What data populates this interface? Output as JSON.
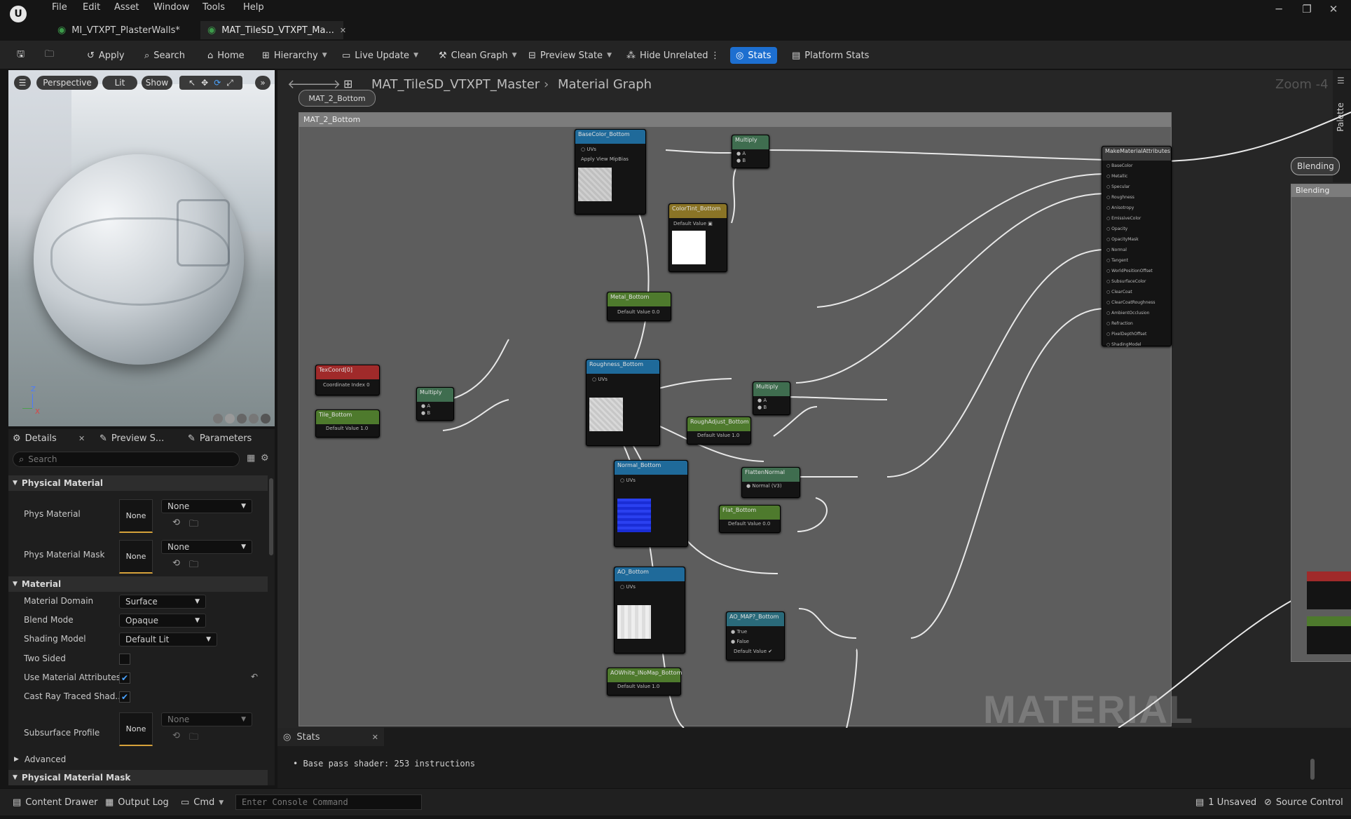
{
  "menu": [
    "File",
    "Edit",
    "Asset",
    "Window",
    "Tools",
    "Help"
  ],
  "tabs": [
    {
      "label": "MI_VTXPT_PlasterWalls*"
    },
    {
      "label": "MAT_TileSD_VTXPT_Ma..."
    }
  ],
  "toolbar": {
    "apply": "Apply",
    "search": "Search",
    "home": "Home",
    "hierarchy": "Hierarchy",
    "live_update": "Live Update",
    "clean_graph": "Clean Graph",
    "preview_state": "Preview State",
    "hide_unrelated": "Hide Unrelated",
    "stats": "Stats",
    "platform_stats": "Platform Stats"
  },
  "viewport": {
    "perspective": "Perspective",
    "lit": "Lit",
    "show": "Show"
  },
  "details": {
    "tabs": [
      "Details",
      "Preview S...",
      "Parameters"
    ],
    "search_placeholder": "Search",
    "sections": {
      "physical_material": "Physical Material",
      "material": "Material",
      "advanced": "Advanced",
      "physical_material_mask": "Physical Material Mask"
    },
    "phys_material": {
      "label": "Phys Material",
      "thumb": "None",
      "value": "None"
    },
    "phys_material_mask": {
      "label": "Phys Material Mask",
      "thumb": "None",
      "value": "None"
    },
    "material_domain": {
      "label": "Material Domain",
      "value": "Surface"
    },
    "blend_mode": {
      "label": "Blend Mode",
      "value": "Opaque"
    },
    "shading_model": {
      "label": "Shading Model",
      "value": "Default Lit"
    },
    "two_sided": {
      "label": "Two Sided",
      "checked": false
    },
    "use_material_attributes": {
      "label": "Use Material Attributes",
      "checked": true
    },
    "cast_ray_traced": {
      "label": "Cast Ray Traced Shad...",
      "checked": true
    },
    "subsurface_profile": {
      "label": "Subsurface Profile",
      "thumb": "None",
      "value": "None"
    }
  },
  "graph": {
    "breadcrumb_asset": "MAT_TileSD_VTXPT_Master",
    "breadcrumb_page": "Material Graph",
    "zoom": "Zoom -4",
    "palette": "Palette",
    "comment_bubble": "MAT_2_Bottom",
    "comment_title": "MAT_2_Bottom",
    "watermark": "MATERIAL",
    "blending_1": "Blending",
    "blending_2": "Blending",
    "nodes": {
      "basecolor": "BaseColor_Bottom",
      "multiply1": "Multiply",
      "colortint": "ColorTint_Bottom",
      "metal": "Metal_Bottom",
      "texcoord": "TexCoord[0]",
      "tile": "Tile_Bottom",
      "multiply_uv": "Multiply",
      "roughness": "Roughness_Bottom",
      "multiply2": "Multiply",
      "roughadjust": "RoughAdjust_Bottom",
      "normal": "Normal_Bottom",
      "flatten": "FlattenNormal",
      "flat": "Flat_Bottom",
      "ao": "AO_Bottom",
      "aomap": "AO_MAP?_Bottom",
      "aowhite": "AOWhite_INoMap_Bottom",
      "make_attrs": "MakeMaterialAttributes"
    },
    "attr_pins": [
      "BaseColor",
      "Metallic",
      "Specular",
      "Roughness",
      "Anisotropy",
      "EmissiveColor",
      "Opacity",
      "OpacityMask",
      "Normal",
      "Tangent",
      "WorldPositionOffset",
      "SubsurfaceColor",
      "ClearCoat",
      "ClearCoatRoughness",
      "AmbientOcclusion",
      "Refraction",
      "PixelDepthOffset",
      "ShadingModel"
    ]
  },
  "stats_panel": {
    "title": "Stats",
    "line1": "Base pass shader: 253 instructions"
  },
  "statusbar": {
    "content_drawer": "Content Drawer",
    "output_log": "Output Log",
    "cmd": "Cmd",
    "console_placeholder": "Enter Console Command",
    "unsaved": "1 Unsaved",
    "source_control": "Source Control"
  }
}
